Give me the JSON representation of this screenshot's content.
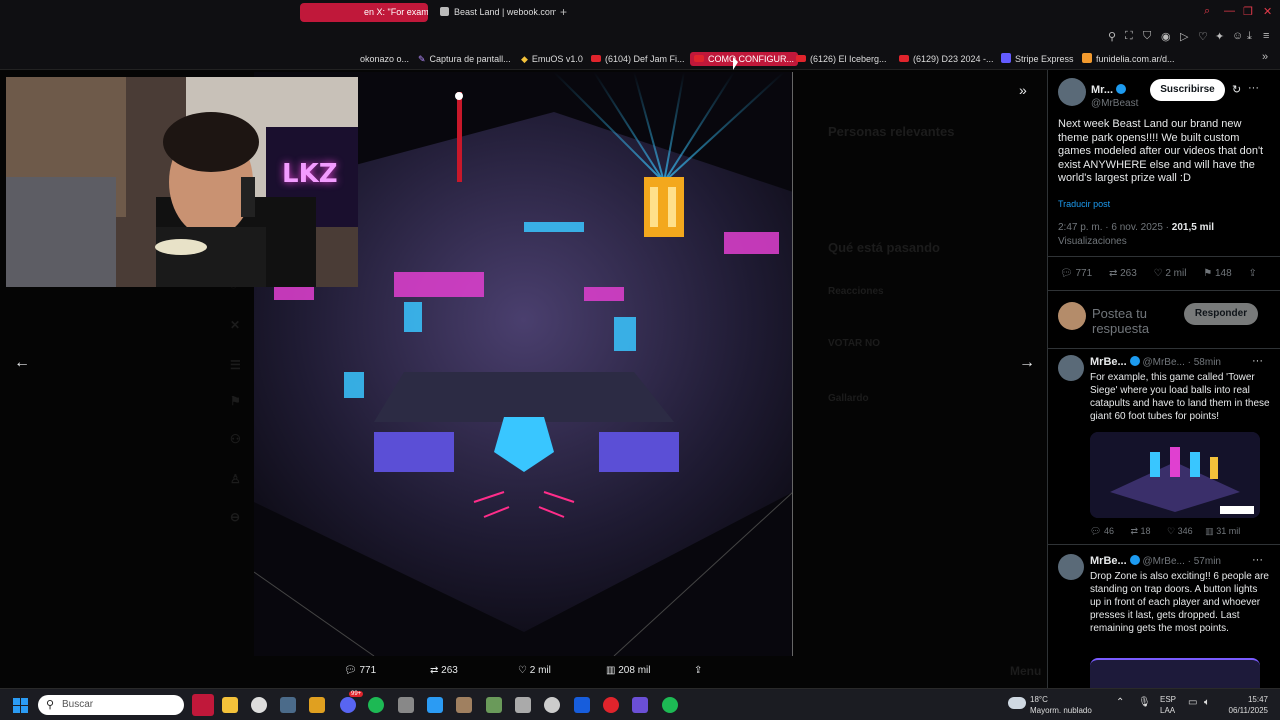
{
  "tabs": [
    {
      "label": "en X: \"For exam",
      "active": true
    },
    {
      "label": "Beast Land | webook.com",
      "active": false
    }
  ],
  "bookmarks": [
    {
      "label": "okonazo o..."
    },
    {
      "label": "Captura de pantall..."
    },
    {
      "label": "EmuOS v1.0"
    },
    {
      "label": "(6104) Def Jam Fi..."
    },
    {
      "label": "COMO CONFIGUR...",
      "active": true
    },
    {
      "label": "(6126) El Iceberg..."
    },
    {
      "label": "(6129) D23 2024 -..."
    },
    {
      "label": "Stripe Express"
    },
    {
      "label": "funidelia.com.ar/d..."
    }
  ],
  "background_ghost": {
    "relevant": "Personas relevantes",
    "happening": "Qué está pasando",
    "t1": "Reacciones",
    "t2": "VOTAR NO",
    "t3": "Gallardo",
    "menu": "Menu"
  },
  "media_actions": {
    "replies": "771",
    "reposts": "263",
    "likes": "2 mil",
    "views": "208 mil"
  },
  "main_post": {
    "author": "Mr...",
    "handle": "@MrBeast",
    "subscribe": "Suscribirse",
    "text": "Next week Beast Land our brand new theme park opens!!!! We built custom games modeled after our videos that don't exist ANYWHERE else and will have the world's largest prize wall :D",
    "translate": "Traducir post",
    "timestamp": "2:47 p. m. · 6 nov. 2025 ·",
    "views_count": "201,5 mil",
    "views_label": "Visualizaciones",
    "replies": "771",
    "reposts": "263",
    "likes": "2 mil",
    "bookmarks": "148"
  },
  "compose": {
    "placeholder": "Postea tu respuesta",
    "button": "Responder"
  },
  "replies": [
    {
      "author": "MrBe...",
      "handle": "@MrBe...",
      "time": "· 58min",
      "text": "For example, this game called 'Tower Siege' where you load balls into real catapults and have to land them in these giant 60 foot tubes for points!",
      "replies": "46",
      "reposts": "18",
      "likes": "346",
      "views": "31 mil"
    },
    {
      "author": "MrBe...",
      "handle": "@MrBe...",
      "time": "· 57min",
      "text": "Drop Zone is also exciting!! 6 people are standing on trap doors. A button lights up in front of each player and whoever presses it last, gets dropped. Last remaining gets the most points."
    }
  ],
  "taskbar": {
    "search_placeholder": "Buscar",
    "weather_temp": "18°C",
    "weather_desc": "Mayorm. nublado",
    "lang_top": "ESP",
    "lang_bottom": "LAA",
    "time": "15:47",
    "date": "06/11/2025",
    "discord_badge": "99+"
  },
  "webcam": {
    "sign": "LKZ"
  },
  "colors": {
    "accent_tab": "#c0183a",
    "x_blue": "#1d9bf0",
    "neon_pink": "#e040d0",
    "neon_cyan": "#39c6ff"
  }
}
